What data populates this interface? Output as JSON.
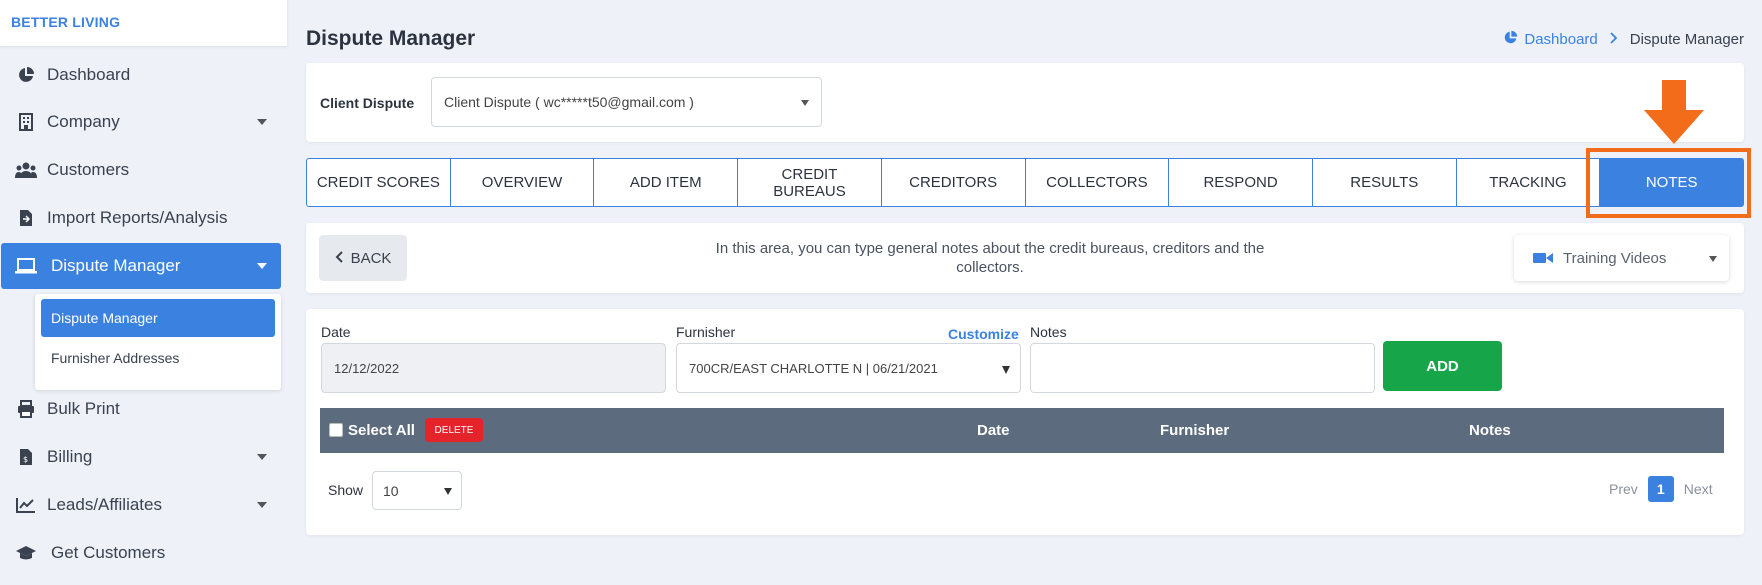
{
  "brand": "BETTER LIVING",
  "sidebar": {
    "items": [
      {
        "label": "Dashboard",
        "icon": "pie-chart-icon"
      },
      {
        "label": "Company",
        "icon": "building-icon"
      },
      {
        "label": "Customers",
        "icon": "users-icon"
      },
      {
        "label": "Import Reports/Analysis",
        "icon": "file-import-icon"
      },
      {
        "label": "Dispute Manager",
        "icon": "laptop-icon"
      },
      {
        "label": "Bulk Print",
        "icon": "printer-icon"
      },
      {
        "label": "Billing",
        "icon": "invoice-icon"
      },
      {
        "label": "Leads/Affiliates",
        "icon": "chart-line-icon"
      },
      {
        "label": "Get Customers",
        "icon": "graduation-cap-icon"
      }
    ],
    "submenu": [
      "Dispute Manager",
      "Furnisher Addresses"
    ]
  },
  "page": {
    "title": "Dispute Manager",
    "breadcrumb": {
      "home": "Dashboard",
      "current": "Dispute Manager"
    }
  },
  "client_dispute": {
    "label": "Client Dispute",
    "value": "Client Dispute ( wc*****t50@gmail.com )"
  },
  "tabs": [
    {
      "label": "CREDIT SCORES"
    },
    {
      "label": "OVERVIEW"
    },
    {
      "label": "ADD ITEM"
    },
    {
      "label": "CREDIT\nBUREAUS"
    },
    {
      "label": "CREDITORS"
    },
    {
      "label": "COLLECTORS"
    },
    {
      "label": "RESPOND"
    },
    {
      "label": "RESULTS"
    },
    {
      "label": "TRACKING"
    },
    {
      "label": "NOTES"
    }
  ],
  "notes_panel": {
    "back_label": "BACK",
    "info": "In this area, you can type general notes about the credit bureaus, creditors and the collectors.",
    "training_label": "Training Videos"
  },
  "form": {
    "date_label": "Date",
    "date_value": "12/12/2022",
    "furnisher_label": "Furnisher",
    "customize_label": "Customize",
    "furnisher_value": "700CR/EAST CHARLOTTE N | 06/21/2021",
    "notes_label": "Notes",
    "notes_value": "",
    "add_label": "ADD"
  },
  "table": {
    "select_all": "Select All",
    "delete_label": "DELETE",
    "columns": [
      "Date",
      "Furnisher",
      "Notes"
    ]
  },
  "footer": {
    "show_label": "Show",
    "show_value": "10",
    "prev": "Prev",
    "page": "1",
    "next": "Next"
  },
  "colors": {
    "accent": "#3b82e0",
    "highlight": "#f26c1a",
    "add_button": "#17a54a",
    "delete_button": "#e5232b",
    "table_header": "#5c6b7e"
  }
}
